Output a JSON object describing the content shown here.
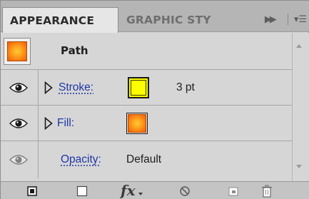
{
  "tabs": [
    {
      "label": "APPEARANCE",
      "active": true
    },
    {
      "label": "GRAPHIC STY",
      "active": false
    }
  ],
  "tab_controls": {
    "expand_icon": "double-chevron-right-icon",
    "menu_icon": "panel-menu-icon"
  },
  "object": {
    "label": "Path",
    "thumbnail": "gradient-swatch"
  },
  "attributes": {
    "stroke": {
      "label": "Stroke:",
      "value": "3 pt",
      "color": "#ffff00"
    },
    "fill": {
      "label": "Fill:",
      "type": "radial-gradient",
      "colors": [
        "#ffcc33",
        "#ff9a1a",
        "#f05a0a"
      ]
    },
    "opacity": {
      "label": "Opacity:",
      "value": "Default"
    }
  },
  "colors": {
    "link": "#1f36a6",
    "panel": "#d6d6d6",
    "tabbar": "#b5b5b5"
  },
  "toolbar": {
    "buttons": [
      "add-new-stroke-icon",
      "add-new-fill-icon",
      "fx-effect-icon",
      "clear-appearance-icon",
      "duplicate-item-icon",
      "delete-item-icon"
    ],
    "fx_label": "fx"
  }
}
